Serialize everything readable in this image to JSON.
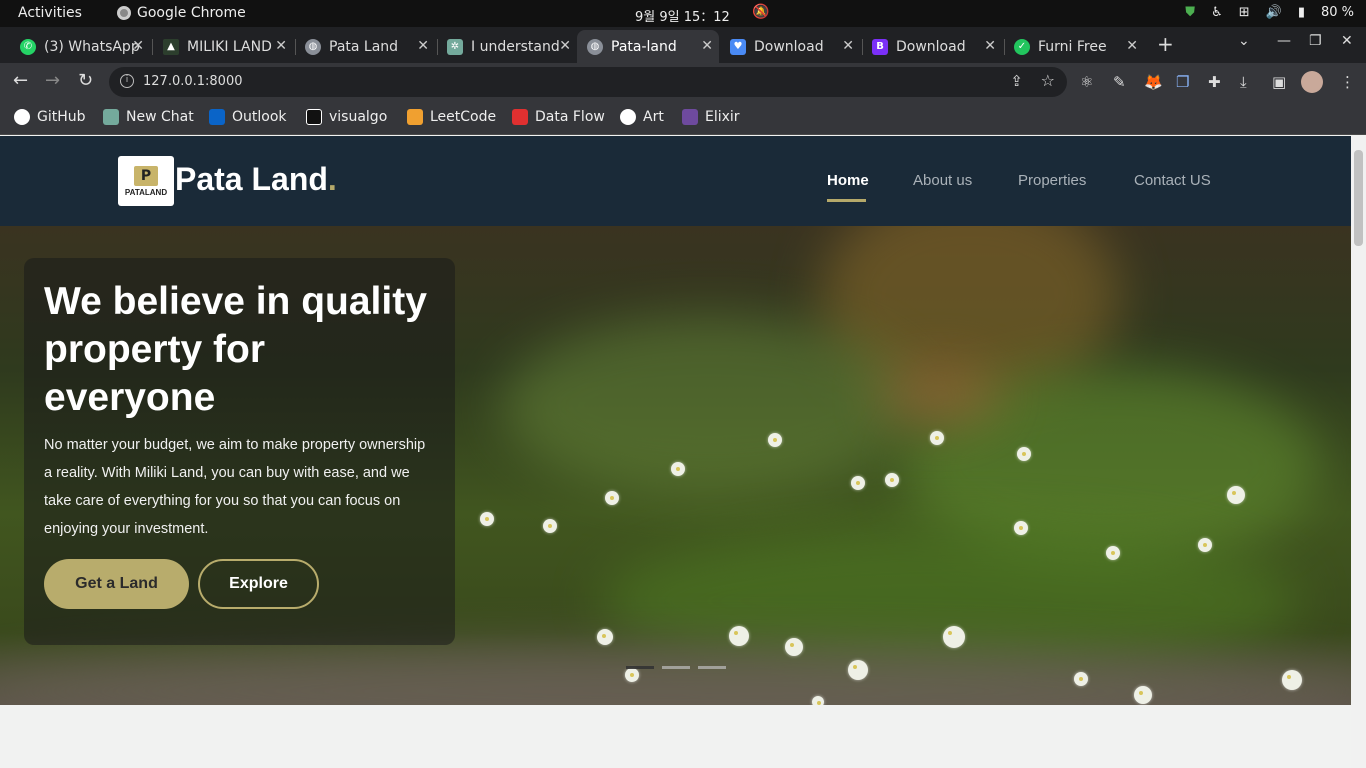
{
  "os": {
    "activities": "Activities",
    "app": "Google Chrome",
    "clock": "9월 9일  15：12",
    "battery": "80 %"
  },
  "tabs": [
    {
      "title": "(3) WhatsApp",
      "favicon_color": "#25d366",
      "icon": "whatsapp-icon"
    },
    {
      "title": "MILIKI LAND",
      "favicon_color": "#2c3e2d",
      "icon": "miliki-icon"
    },
    {
      "title": "Pata Land",
      "favicon_color": "#8a8f98",
      "icon": "globe-icon"
    },
    {
      "title": "I understand",
      "favicon_color": "#74aa9c",
      "icon": "chatgpt-icon"
    },
    {
      "title": "Pata-land",
      "favicon_color": "#8a8f98",
      "icon": "globe-icon",
      "active": true
    },
    {
      "title": "Download",
      "favicon_color": "#4a8af4",
      "icon": "heart-icon"
    },
    {
      "title": "Download",
      "favicon_color": "#7b2ff7",
      "icon": "bootstrap-icon"
    },
    {
      "title": "Furni Free",
      "favicon_color": "#22c55e",
      "icon": "furni-icon"
    }
  ],
  "omnibox": {
    "url": "127.0.0.1:8000"
  },
  "bookmarks": [
    {
      "label": "GitHub",
      "color": "#ffffff"
    },
    {
      "label": "New Chat",
      "color": "#74aa9c"
    },
    {
      "label": "Outlook",
      "color": "#0a64c8"
    },
    {
      "label": "visualgo",
      "color": "#111111"
    },
    {
      "label": "LeetCode",
      "color": "#f0a030"
    },
    {
      "label": "Data Flow",
      "color": "#e03030"
    },
    {
      "label": "Art",
      "color": "#ffffff"
    },
    {
      "label": "Elixir",
      "color": "#6e4a9e"
    }
  ],
  "site": {
    "logo_text": "PATALAND",
    "brand": "Pata Land",
    "brand_dot": ".",
    "nav": [
      "Home",
      "About us",
      "Properties",
      "Contact US"
    ],
    "accent": "#b5a96a",
    "hero": {
      "title": "We believe in quality property for everyone",
      "text": "No matter your budget, we aim to make property ownership a reality. With Miliki Land, you can buy with ease, and we take care of everything for you so that you can focus on enjoying your investment.",
      "primary_button": "Get a Land",
      "secondary_button": "Explore"
    }
  }
}
